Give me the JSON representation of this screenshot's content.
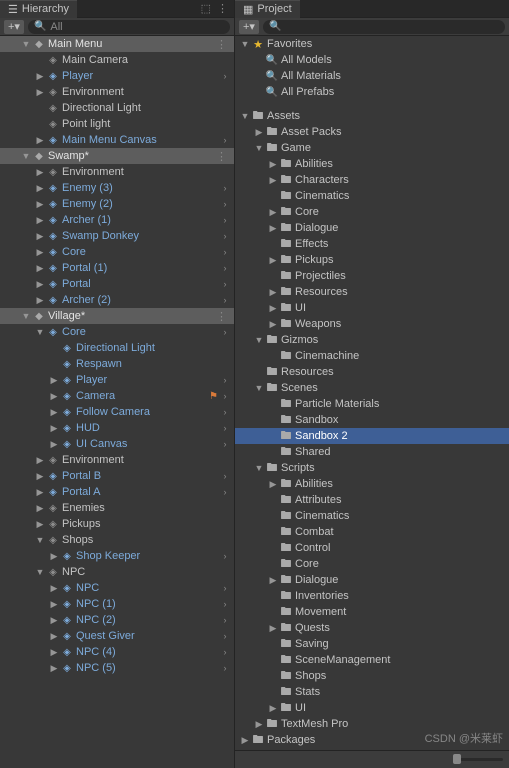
{
  "hierarchy": {
    "title": "Hierarchy",
    "search_placeholder": "All",
    "items": [
      {
        "depth": 0,
        "arrow": "down",
        "icon": "unity",
        "label": "Main Menu",
        "scene": true,
        "more": true
      },
      {
        "depth": 1,
        "arrow": "none",
        "icon": "cube-gray",
        "label": "Main Camera"
      },
      {
        "depth": 1,
        "arrow": "right",
        "icon": "cube",
        "label": "Player",
        "blue": true,
        "chev": true
      },
      {
        "depth": 1,
        "arrow": "right",
        "icon": "cube-gray",
        "label": "Environment"
      },
      {
        "depth": 1,
        "arrow": "none",
        "icon": "cube-gray",
        "label": "Directional Light"
      },
      {
        "depth": 1,
        "arrow": "none",
        "icon": "cube-gray",
        "label": "Point light"
      },
      {
        "depth": 1,
        "arrow": "right",
        "icon": "cube",
        "label": "Main Menu Canvas",
        "blue": true,
        "chev": true
      },
      {
        "depth": 0,
        "arrow": "down",
        "icon": "unity",
        "label": "Swamp*",
        "scene": true,
        "more": true
      },
      {
        "depth": 1,
        "arrow": "right",
        "icon": "cube-gray",
        "label": "Environment"
      },
      {
        "depth": 1,
        "arrow": "right",
        "icon": "cube",
        "label": "Enemy (3)",
        "blue": true,
        "chev": true
      },
      {
        "depth": 1,
        "arrow": "right",
        "icon": "cube",
        "label": "Enemy (2)",
        "blue": true,
        "chev": true
      },
      {
        "depth": 1,
        "arrow": "right",
        "icon": "cube",
        "label": "Archer (1)",
        "blue": true,
        "chev": true
      },
      {
        "depth": 1,
        "arrow": "right",
        "icon": "cube",
        "label": "Swamp Donkey",
        "blue": true,
        "chev": true
      },
      {
        "depth": 1,
        "arrow": "right",
        "icon": "cube",
        "label": "Core",
        "blue": true,
        "chev": true
      },
      {
        "depth": 1,
        "arrow": "right",
        "icon": "cube",
        "label": "Portal (1)",
        "blue": true,
        "chev": true
      },
      {
        "depth": 1,
        "arrow": "right",
        "icon": "cube",
        "label": "Portal",
        "blue": true,
        "chev": true
      },
      {
        "depth": 1,
        "arrow": "right",
        "icon": "cube",
        "label": "Archer (2)",
        "blue": true,
        "chev": true
      },
      {
        "depth": 0,
        "arrow": "down",
        "icon": "unity",
        "label": "Village*",
        "scene": true,
        "more": true
      },
      {
        "depth": 1,
        "arrow": "down",
        "icon": "cube",
        "label": "Core",
        "blue": true,
        "chev": true
      },
      {
        "depth": 2,
        "arrow": "none",
        "icon": "cube",
        "label": "Directional Light",
        "blue": true
      },
      {
        "depth": 2,
        "arrow": "none",
        "icon": "cube",
        "label": "Respawn",
        "blue": true
      },
      {
        "depth": 2,
        "arrow": "right",
        "icon": "cube",
        "label": "Player",
        "blue": true,
        "chev": true
      },
      {
        "depth": 2,
        "arrow": "right",
        "icon": "cube",
        "label": "Camera",
        "blue": true,
        "chev": true,
        "warn": true
      },
      {
        "depth": 2,
        "arrow": "right",
        "icon": "cube",
        "label": "Follow Camera",
        "blue": true,
        "chev": true
      },
      {
        "depth": 2,
        "arrow": "right",
        "icon": "cube",
        "label": "HUD",
        "blue": true,
        "chev": true
      },
      {
        "depth": 2,
        "arrow": "right",
        "icon": "cube",
        "label": "UI Canvas",
        "blue": true,
        "chev": true
      },
      {
        "depth": 1,
        "arrow": "right",
        "icon": "cube-gray",
        "label": "Environment"
      },
      {
        "depth": 1,
        "arrow": "right",
        "icon": "cube",
        "label": "Portal B",
        "blue": true,
        "chev": true
      },
      {
        "depth": 1,
        "arrow": "right",
        "icon": "cube",
        "label": "Portal A",
        "blue": true,
        "chev": true
      },
      {
        "depth": 1,
        "arrow": "right",
        "icon": "cube-gray",
        "label": "Enemies"
      },
      {
        "depth": 1,
        "arrow": "right",
        "icon": "cube-gray",
        "label": "Pickups"
      },
      {
        "depth": 1,
        "arrow": "down",
        "icon": "cube-gray",
        "label": "Shops"
      },
      {
        "depth": 2,
        "arrow": "right",
        "icon": "cube",
        "label": "Shop Keeper",
        "blue": true,
        "chev": true
      },
      {
        "depth": 1,
        "arrow": "down",
        "icon": "cube-gray",
        "label": "NPC"
      },
      {
        "depth": 2,
        "arrow": "right",
        "icon": "cube",
        "label": "NPC",
        "blue": true,
        "chev": true
      },
      {
        "depth": 2,
        "arrow": "right",
        "icon": "cube",
        "label": "NPC (1)",
        "blue": true,
        "chev": true
      },
      {
        "depth": 2,
        "arrow": "right",
        "icon": "cube",
        "label": "NPC (2)",
        "blue": true,
        "chev": true
      },
      {
        "depth": 2,
        "arrow": "right",
        "icon": "cube",
        "label": "Quest Giver",
        "blue": true,
        "chev": true
      },
      {
        "depth": 2,
        "arrow": "right",
        "icon": "cube",
        "label": "NPC (4)",
        "blue": true,
        "chev": true
      },
      {
        "depth": 2,
        "arrow": "right",
        "icon": "cube",
        "label": "NPC (5)",
        "blue": true,
        "chev": true
      }
    ]
  },
  "project": {
    "title": "Project",
    "items": [
      {
        "depth": 0,
        "arrow": "down",
        "icon": "star",
        "label": "Favorites"
      },
      {
        "depth": 1,
        "arrow": "none",
        "icon": "search",
        "label": "All Models"
      },
      {
        "depth": 1,
        "arrow": "none",
        "icon": "search",
        "label": "All Materials"
      },
      {
        "depth": 1,
        "arrow": "none",
        "icon": "search",
        "label": "All Prefabs"
      },
      {
        "depth": 0,
        "arrow": "none",
        "icon": "none",
        "label": "",
        "spacer": true
      },
      {
        "depth": 0,
        "arrow": "down",
        "icon": "folder",
        "label": "Assets"
      },
      {
        "depth": 1,
        "arrow": "right",
        "icon": "folder",
        "label": "Asset Packs"
      },
      {
        "depth": 1,
        "arrow": "down",
        "icon": "folder",
        "label": "Game"
      },
      {
        "depth": 2,
        "arrow": "right",
        "icon": "folder",
        "label": "Abilities"
      },
      {
        "depth": 2,
        "arrow": "right",
        "icon": "folder",
        "label": "Characters"
      },
      {
        "depth": 2,
        "arrow": "none",
        "icon": "folder",
        "label": "Cinematics"
      },
      {
        "depth": 2,
        "arrow": "right",
        "icon": "folder",
        "label": "Core"
      },
      {
        "depth": 2,
        "arrow": "right",
        "icon": "folder",
        "label": "Dialogue"
      },
      {
        "depth": 2,
        "arrow": "none",
        "icon": "folder",
        "label": "Effects"
      },
      {
        "depth": 2,
        "arrow": "right",
        "icon": "folder",
        "label": "Pickups"
      },
      {
        "depth": 2,
        "arrow": "none",
        "icon": "folder",
        "label": "Projectiles"
      },
      {
        "depth": 2,
        "arrow": "right",
        "icon": "folder",
        "label": "Resources"
      },
      {
        "depth": 2,
        "arrow": "right",
        "icon": "folder",
        "label": "UI"
      },
      {
        "depth": 2,
        "arrow": "right",
        "icon": "folder",
        "label": "Weapons"
      },
      {
        "depth": 1,
        "arrow": "down",
        "icon": "folder",
        "label": "Gizmos"
      },
      {
        "depth": 2,
        "arrow": "none",
        "icon": "folder",
        "label": "Cinemachine"
      },
      {
        "depth": 1,
        "arrow": "none",
        "icon": "folder",
        "label": "Resources"
      },
      {
        "depth": 1,
        "arrow": "down",
        "icon": "folder",
        "label": "Scenes"
      },
      {
        "depth": 2,
        "arrow": "none",
        "icon": "folder",
        "label": "Particle Materials"
      },
      {
        "depth": 2,
        "arrow": "none",
        "icon": "folder",
        "label": "Sandbox"
      },
      {
        "depth": 2,
        "arrow": "none",
        "icon": "folder",
        "label": "Sandbox 2",
        "selected": true
      },
      {
        "depth": 2,
        "arrow": "none",
        "icon": "folder",
        "label": "Shared"
      },
      {
        "depth": 1,
        "arrow": "down",
        "icon": "folder",
        "label": "Scripts"
      },
      {
        "depth": 2,
        "arrow": "right",
        "icon": "folder",
        "label": "Abilities"
      },
      {
        "depth": 2,
        "arrow": "none",
        "icon": "folder",
        "label": "Attributes"
      },
      {
        "depth": 2,
        "arrow": "none",
        "icon": "folder",
        "label": "Cinematics"
      },
      {
        "depth": 2,
        "arrow": "none",
        "icon": "folder",
        "label": "Combat"
      },
      {
        "depth": 2,
        "arrow": "none",
        "icon": "folder",
        "label": "Control"
      },
      {
        "depth": 2,
        "arrow": "none",
        "icon": "folder",
        "label": "Core"
      },
      {
        "depth": 2,
        "arrow": "right",
        "icon": "folder",
        "label": "Dialogue"
      },
      {
        "depth": 2,
        "arrow": "none",
        "icon": "folder",
        "label": "Inventories"
      },
      {
        "depth": 2,
        "arrow": "none",
        "icon": "folder",
        "label": "Movement"
      },
      {
        "depth": 2,
        "arrow": "right",
        "icon": "folder",
        "label": "Quests"
      },
      {
        "depth": 2,
        "arrow": "none",
        "icon": "folder",
        "label": "Saving"
      },
      {
        "depth": 2,
        "arrow": "none",
        "icon": "folder",
        "label": "SceneManagement"
      },
      {
        "depth": 2,
        "arrow": "none",
        "icon": "folder",
        "label": "Shops"
      },
      {
        "depth": 2,
        "arrow": "none",
        "icon": "folder",
        "label": "Stats"
      },
      {
        "depth": 2,
        "arrow": "right",
        "icon": "folder",
        "label": "UI"
      },
      {
        "depth": 1,
        "arrow": "right",
        "icon": "folder",
        "label": "TextMesh Pro"
      },
      {
        "depth": 0,
        "arrow": "right",
        "icon": "folder",
        "label": "Packages"
      }
    ]
  },
  "watermark": "CSDN @米莱虾"
}
